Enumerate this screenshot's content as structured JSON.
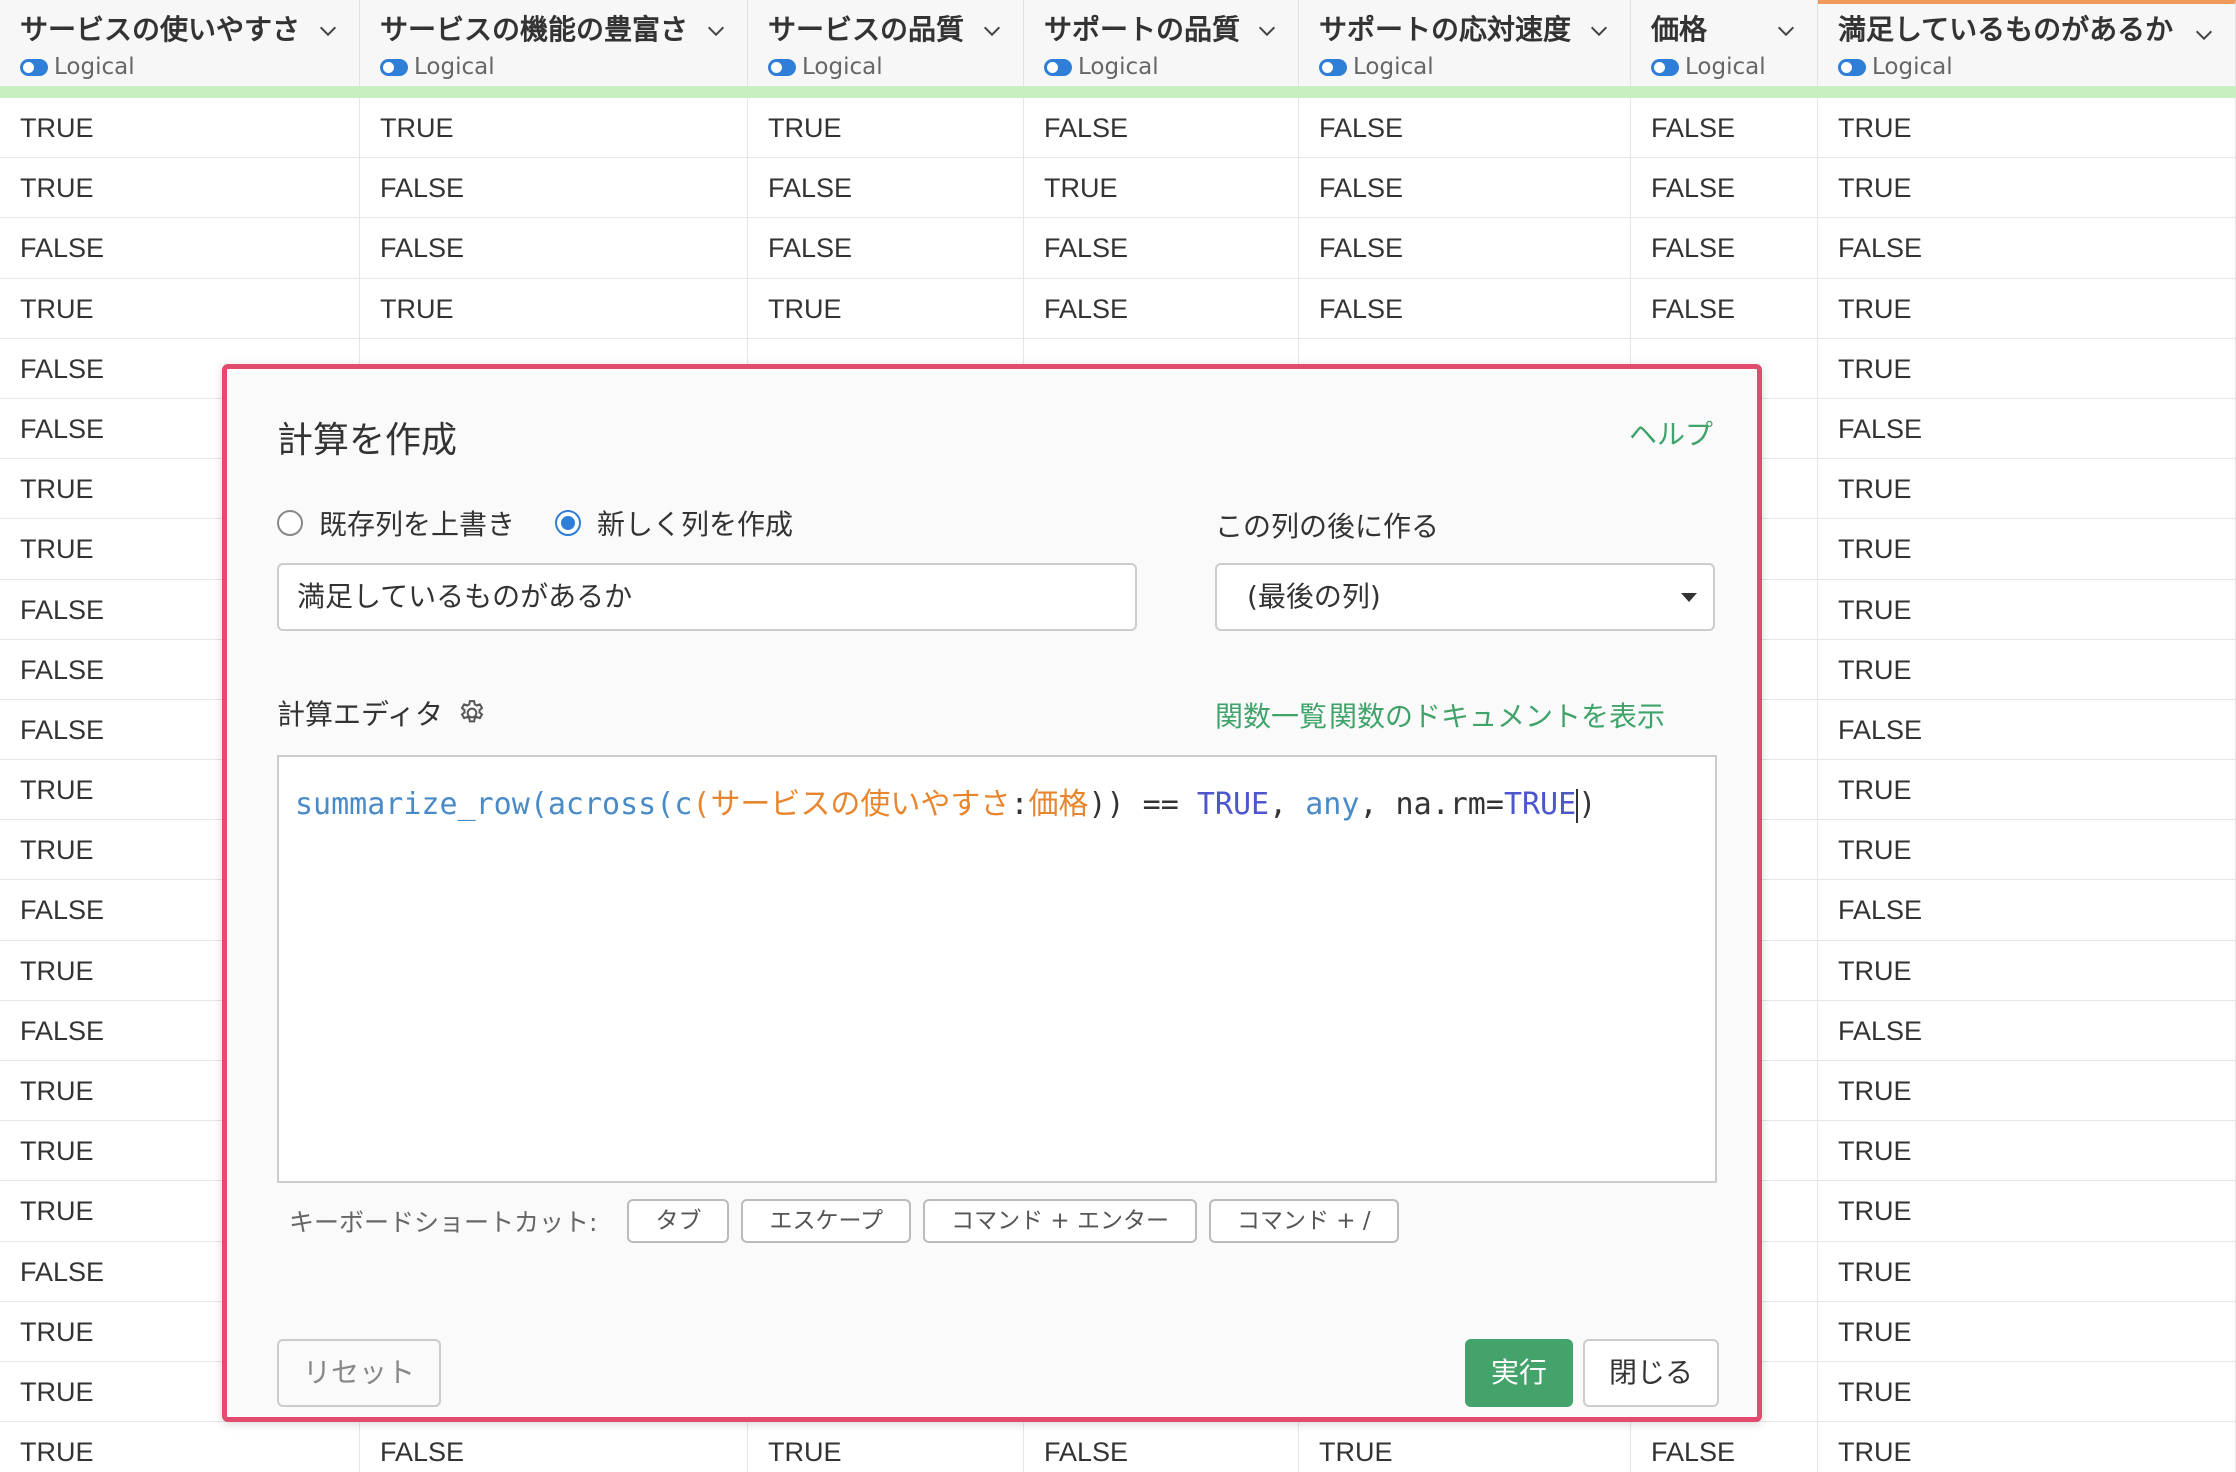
{
  "columns": [
    {
      "title": "サービスの使いやすさ",
      "type": "Logical"
    },
    {
      "title": "サービスの機能の豊富さ",
      "type": "Logical"
    },
    {
      "title": "サービスの品質",
      "type": "Logical"
    },
    {
      "title": "サポートの品質",
      "type": "Logical"
    },
    {
      "title": "サポートの応対速度",
      "type": "Logical"
    },
    {
      "title": "価格",
      "type": "Logical"
    },
    {
      "title": "満足しているものがあるか",
      "type": "Logical"
    }
  ],
  "rows": [
    [
      "TRUE",
      "TRUE",
      "TRUE",
      "FALSE",
      "FALSE",
      "FALSE",
      "TRUE"
    ],
    [
      "TRUE",
      "FALSE",
      "FALSE",
      "TRUE",
      "FALSE",
      "FALSE",
      "TRUE"
    ],
    [
      "FALSE",
      "FALSE",
      "FALSE",
      "FALSE",
      "FALSE",
      "FALSE",
      "FALSE"
    ],
    [
      "TRUE",
      "TRUE",
      "TRUE",
      "FALSE",
      "FALSE",
      "FALSE",
      "TRUE"
    ],
    [
      "FALSE",
      "",
      "",
      "",
      "",
      "",
      "TRUE"
    ],
    [
      "FALSE",
      "",
      "",
      "",
      "",
      "",
      "FALSE"
    ],
    [
      "TRUE",
      "",
      "",
      "",
      "",
      "",
      "TRUE"
    ],
    [
      "TRUE",
      "",
      "",
      "",
      "",
      "",
      "TRUE"
    ],
    [
      "FALSE",
      "",
      "",
      "",
      "",
      "",
      "TRUE"
    ],
    [
      "FALSE",
      "",
      "",
      "",
      "",
      "",
      "TRUE"
    ],
    [
      "FALSE",
      "",
      "",
      "",
      "",
      "",
      "FALSE"
    ],
    [
      "TRUE",
      "",
      "",
      "",
      "",
      "",
      "TRUE"
    ],
    [
      "TRUE",
      "",
      "",
      "",
      "",
      "",
      "TRUE"
    ],
    [
      "FALSE",
      "",
      "",
      "",
      "",
      "",
      "FALSE"
    ],
    [
      "TRUE",
      "",
      "",
      "",
      "",
      "",
      "TRUE"
    ],
    [
      "FALSE",
      "",
      "",
      "",
      "",
      "",
      "FALSE"
    ],
    [
      "TRUE",
      "",
      "",
      "",
      "",
      "",
      "TRUE"
    ],
    [
      "TRUE",
      "",
      "",
      "",
      "",
      "",
      "TRUE"
    ],
    [
      "TRUE",
      "",
      "",
      "",
      "",
      "",
      "TRUE"
    ],
    [
      "FALSE",
      "",
      "",
      "",
      "",
      "",
      "TRUE"
    ],
    [
      "TRUE",
      "",
      "",
      "",
      "",
      "",
      "TRUE"
    ],
    [
      "TRUE",
      "",
      "",
      "",
      "",
      "",
      "TRUE"
    ],
    [
      "TRUE",
      "FALSE",
      "TRUE",
      "FALSE",
      "TRUE",
      "FALSE",
      "TRUE"
    ]
  ],
  "modal": {
    "title": "計算を作成",
    "help": "ヘルプ",
    "radio_overwrite": "既存列を上書き",
    "radio_new": "新しく列を作成",
    "after_label": "この列の後に作る",
    "column_name_value": "満足しているものがあるか",
    "select_value": "(最後の列)",
    "editor_label": "計算エディタ",
    "func_list": "関数一覧",
    "func_docs": "関数のドキュメントを表示",
    "code": {
      "fn1": "summarize_row",
      "p1": "(",
      "fn2": "across",
      "p2": "(",
      "fn3": "c",
      "p3": "(",
      "col1": "サービスの使いやすさ",
      "colon": ":",
      "col2": "価格",
      "p4": ")) == ",
      "kw1": "TRUE",
      "p5": ", ",
      "fn4": "any",
      "p6": ", na.rm=",
      "kw2": "TRUE",
      "p7": ")"
    },
    "shortcut_label": "キーボードショートカット:",
    "shortcuts": [
      "タブ",
      "エスケープ",
      "コマンド + エンター",
      "コマンド + /"
    ],
    "reset": "リセット",
    "run": "実行",
    "close": "閉じる"
  },
  "colors": {
    "accent_green": "#43a36a",
    "modal_border": "#e24a6e",
    "active_column_top": "#ef9a5a"
  }
}
